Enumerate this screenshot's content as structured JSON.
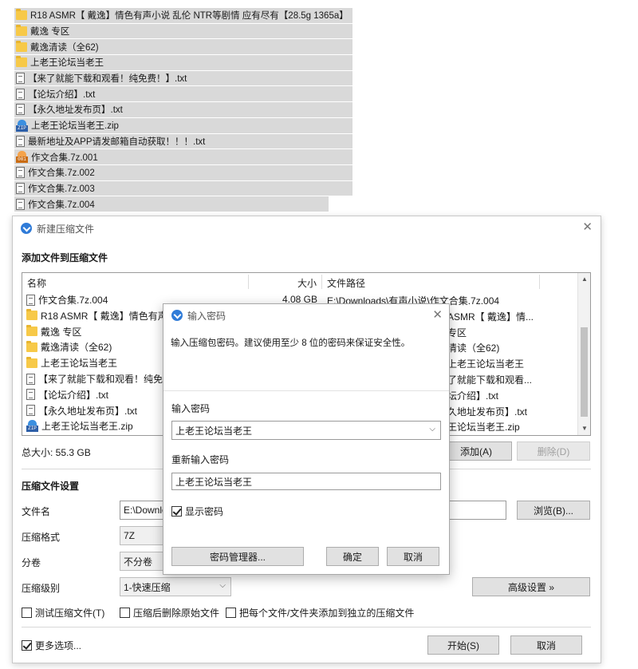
{
  "bg_list": [
    {
      "icon": "folder",
      "label": "R18 ASMR【 戴逸】情色有声小说 乱伦 NTR等剧情 应有尽有【28.5g 1365a】",
      "short": false
    },
    {
      "icon": "folder",
      "label": "戴逸 专区",
      "short": false
    },
    {
      "icon": "folder",
      "label": "戴逸清读（全62)",
      "short": false
    },
    {
      "icon": "folder",
      "label": "上老王论坛当老王",
      "short": false
    },
    {
      "icon": "doc",
      "label": "【来了就能下载和观看！纯免费！】.txt",
      "short": false
    },
    {
      "icon": "doc",
      "label": "【论坛介绍】.txt",
      "short": false
    },
    {
      "icon": "doc",
      "label": "【永久地址发布页】.txt",
      "short": false
    },
    {
      "icon": "zip",
      "label": "上老王论坛当老王.zip",
      "short": false
    },
    {
      "icon": "doc",
      "label": "最新地址及APP请发邮箱自动获取！！！.txt",
      "short": false
    },
    {
      "icon": "zip001",
      "label": "作文合集.7z.001",
      "short": false
    },
    {
      "icon": "doc",
      "label": "作文合集.7z.002",
      "short": false
    },
    {
      "icon": "doc",
      "label": "作文合集.7z.003",
      "short": false
    },
    {
      "icon": "doc",
      "label": "作文合集.7z.004",
      "short": true
    }
  ],
  "main_dialog": {
    "title": "新建压缩文件",
    "add_section": "添加文件到压缩文件",
    "columns": {
      "name": "名称",
      "size": "大小",
      "path": "文件路径"
    },
    "files": [
      {
        "icon": "doc",
        "name": "作文合集.7z.004",
        "size": "4.08 GB",
        "path": "E:\\Downloads\\有声小说\\作文合集.7z.004"
      },
      {
        "icon": "folder",
        "name": "R18 ASMR【 戴逸】情色有声小",
        "size": "",
        "path": "ASMR【 戴逸】情..."
      },
      {
        "icon": "folder",
        "name": "戴逸 专区",
        "size": "",
        "path": "专区"
      },
      {
        "icon": "folder",
        "name": "戴逸清读（全62)",
        "size": "",
        "path": "清读（全62)"
      },
      {
        "icon": "folder",
        "name": "上老王论坛当老王",
        "size": "",
        "path": "上老王论坛当老王"
      },
      {
        "icon": "doc",
        "name": "【来了就能下载和观看！纯免费",
        "size": "",
        "path": "了就能下载和观看..."
      },
      {
        "icon": "doc",
        "name": "【论坛介绍】.txt",
        "size": "",
        "path": "坛介绍】.txt"
      },
      {
        "icon": "doc",
        "name": "【永久地址发布页】.txt",
        "size": "",
        "path": "久地址发布页】.txt"
      },
      {
        "icon": "zip",
        "name": "上老王论坛当老王.zip",
        "size": "",
        "path": "王论坛当老王.zip"
      }
    ],
    "total_size": "总大小: 55.3 GB",
    "add_button": "添加(A)",
    "delete_button": "删除(D)",
    "settings_section": "压缩文件设置",
    "filename_label": "文件名",
    "filename_value": "E:\\Downlo",
    "browse_button": "浏览(B)...",
    "format_label": "压缩格式",
    "format_value": "7Z",
    "split_label": "分卷",
    "split_value": "不分卷",
    "level_label": "压缩级别",
    "level_value": "1-快速压缩",
    "advanced_button": "高级设置 »",
    "test_checkbox": "测试压缩文件(T)",
    "delete_after_checkbox": "压缩后删除原始文件",
    "separate_checkbox": "把每个文件/文件夹添加到独立的压缩文件",
    "more_options": "更多选项...",
    "start_button": "开始(S)",
    "cancel_button": "取消"
  },
  "password_dialog": {
    "title": "输入密码",
    "description": "输入压缩包密码。建议使用至少 8 位的密码来保证安全性。",
    "password_label": "输入密码",
    "password_value": "上老王论坛当老王",
    "reenter_label": "重新输入密码",
    "reenter_value": "上老王论坛当老王",
    "show_password": "显示密码",
    "manager_button": "密码管理器...",
    "ok_button": "确定",
    "cancel_button": "取消"
  }
}
